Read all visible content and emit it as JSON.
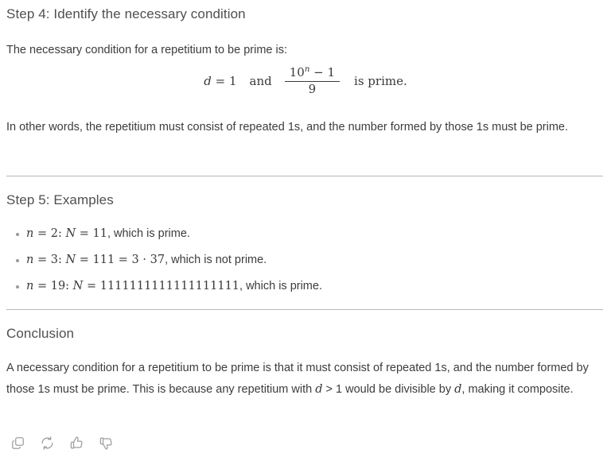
{
  "step4": {
    "heading": "Step 4: Identify the necessary condition",
    "intro": "The necessary condition for a repetitium to be prime is:",
    "equation": {
      "lhs_var": "d",
      "lhs_rel": " = ",
      "lhs_val": "1",
      "conjunction": "and",
      "fraction_numerator_base": "10",
      "fraction_numerator_exponent": "n",
      "fraction_numerator_tail": " − 1",
      "fraction_denominator": "9",
      "tail": "is prime."
    },
    "closing": "In other words, the repetitium must consist of repeated 1s, and the number formed by those 1s must be prime."
  },
  "step5": {
    "heading": "Step 5: Examples",
    "items": [
      {
        "var": "n",
        "value": "2",
        "result_var": "N",
        "result": "11",
        "verdict": ", which is prime."
      },
      {
        "var": "n",
        "value": "3",
        "result_var": "N",
        "result": "111 = 3 · 37",
        "verdict": ", which is not prime."
      },
      {
        "var": "n",
        "value": "19",
        "result_var": "N",
        "result": "1111111111111111111",
        "verdict": ", which is prime."
      }
    ]
  },
  "conclusion": {
    "heading": "Conclusion",
    "text_part1": "A necessary condition for a repetitium to be prime is that it must consist of repeated 1s, and the number formed by those 1s must be prime. This is because any repetitium with ",
    "inline_var1": "d",
    "text_part2": " > 1 would be divisible by ",
    "inline_var2": "d",
    "text_part3": ", making it composite."
  },
  "actions": [
    {
      "name": "copy-icon",
      "label": "Copy"
    },
    {
      "name": "regenerate-icon",
      "label": "Regenerate"
    },
    {
      "name": "thumbs-up-icon",
      "label": "Good response"
    },
    {
      "name": "thumbs-down-icon",
      "label": "Bad response"
    }
  ],
  "colors": {
    "heading": "#4f4f4f",
    "body": "#3c3c3c",
    "divider": "#b8b8b8",
    "icon": "#9e9e9e",
    "bullet": "#9a9a9a"
  }
}
